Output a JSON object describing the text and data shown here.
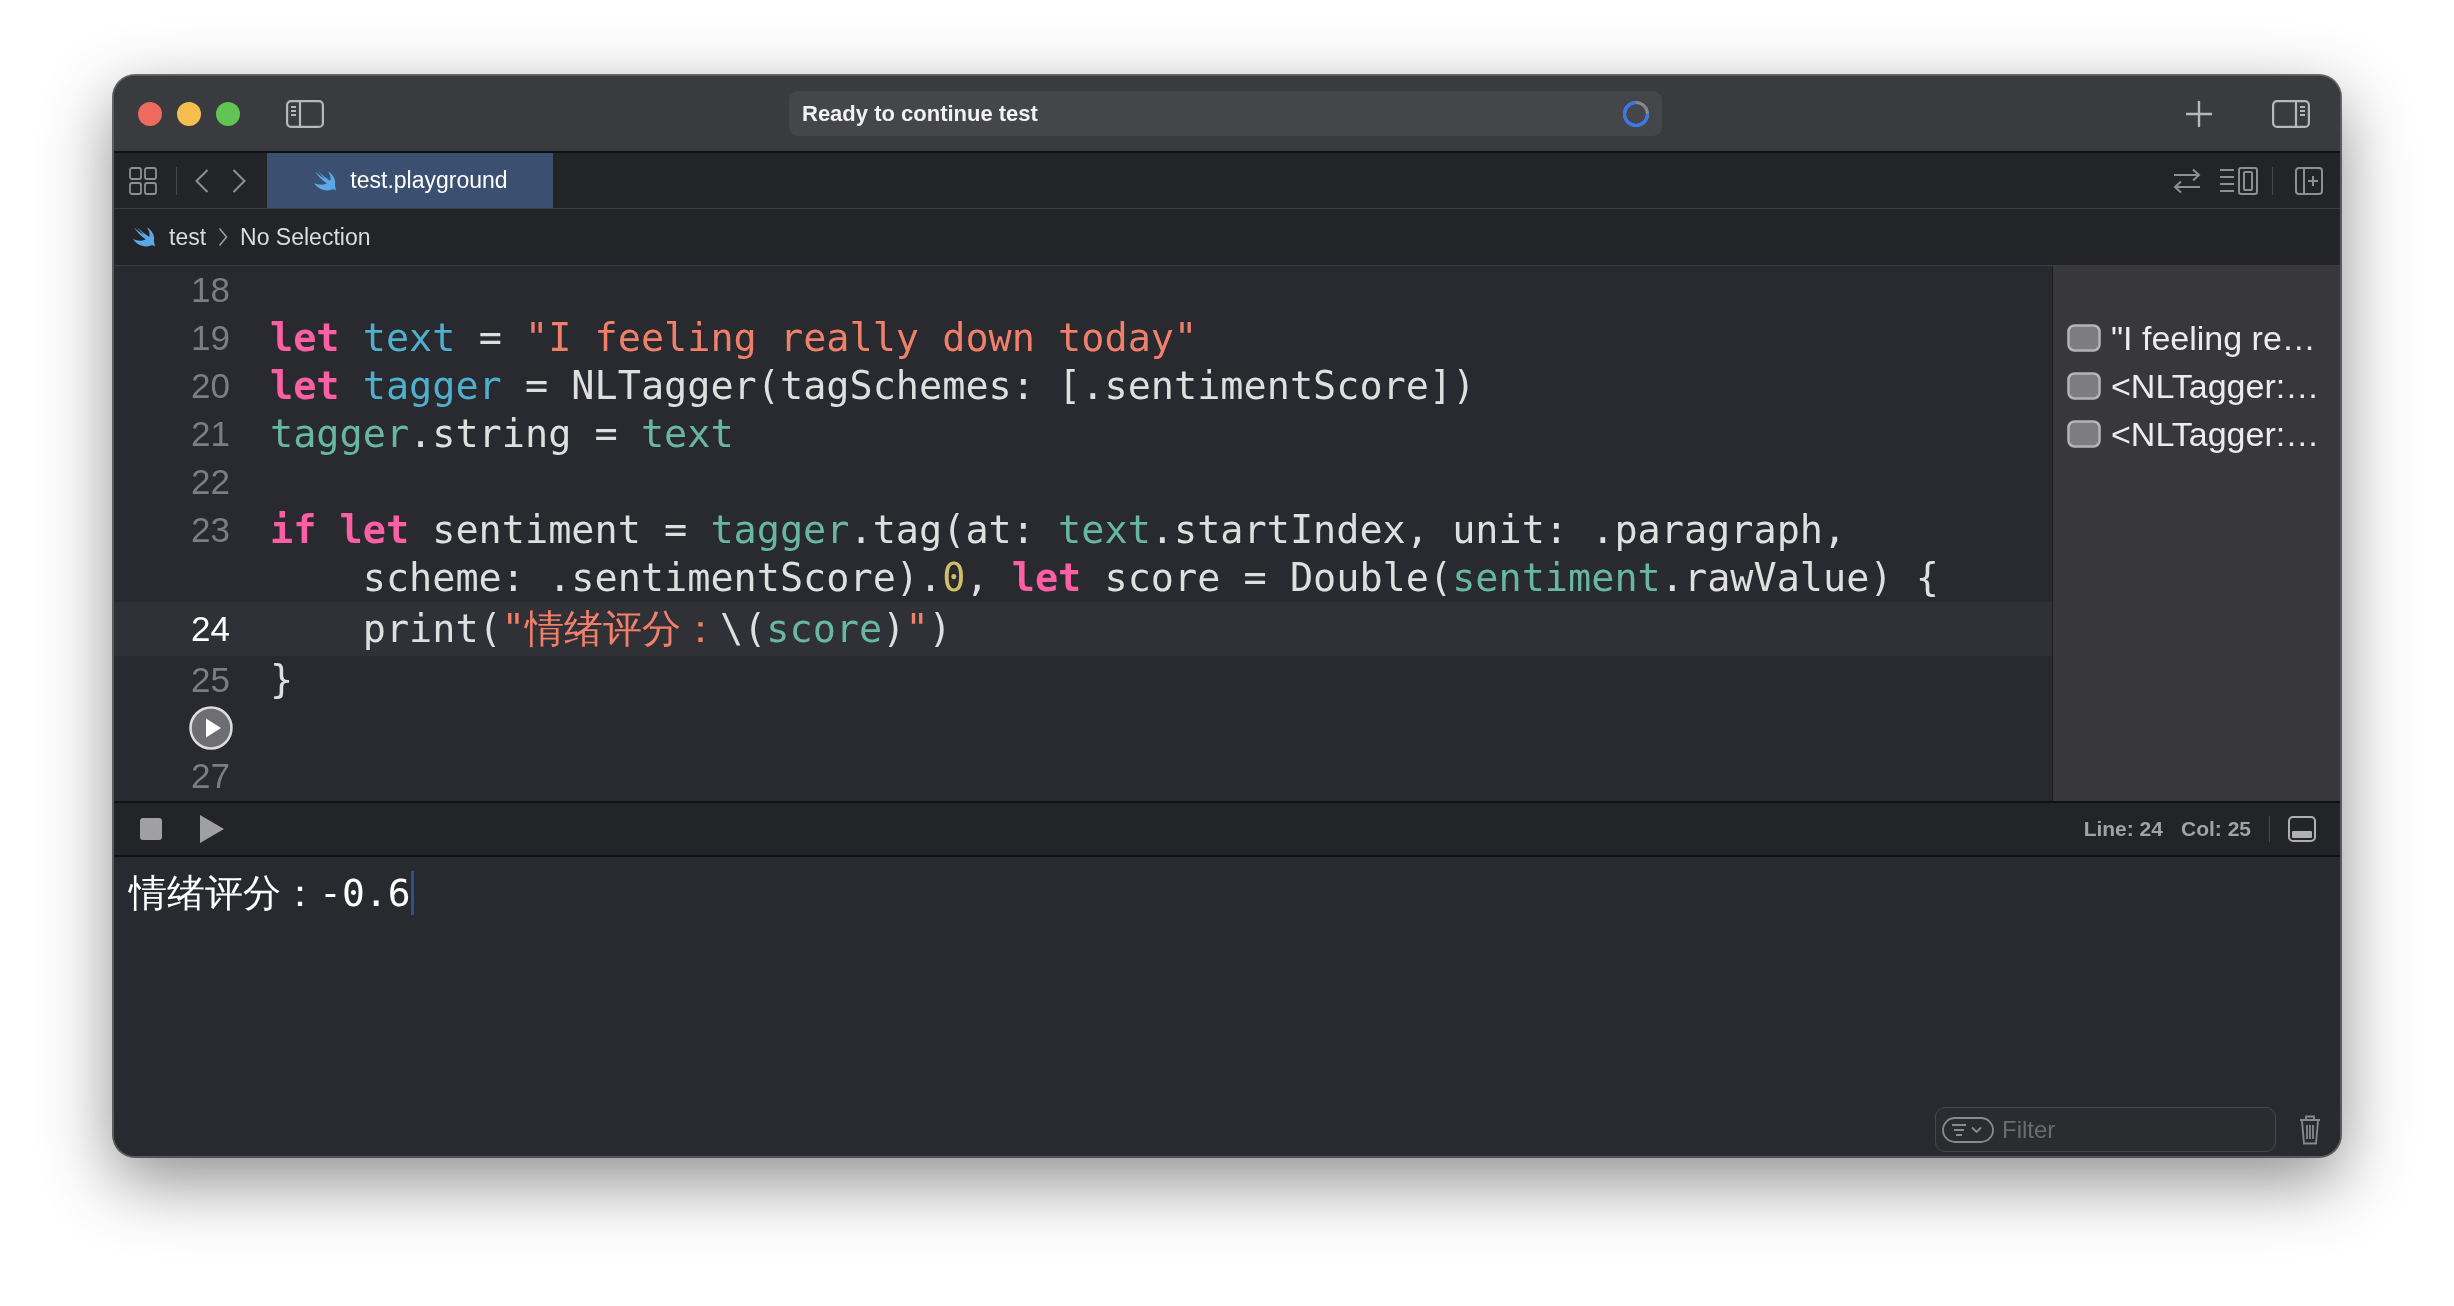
{
  "window": {
    "activity": "Ready to continue test"
  },
  "tabs": [
    {
      "label": "test.playground",
      "selected": true
    }
  ],
  "breadcrumb": [
    {
      "kind": "project",
      "label": "test"
    },
    {
      "kind": "selection",
      "label": "No Selection"
    }
  ],
  "editor": {
    "lines": [
      {
        "kind": "numbered",
        "number": "18",
        "current": false
      },
      {
        "kind": "numbered",
        "number": "19",
        "current": false,
        "rows": [
          {
            "indented": false,
            "tokens": [
              {
                "kind": "keyword",
                "text": "let"
              },
              {
                "kind": "declaration",
                "text": " text"
              },
              {
                "kind": "plain",
                "text": " = "
              },
              {
                "kind": "string",
                "text": "\"I feeling really down today\""
              }
            ]
          }
        ],
        "result": "\"I feeling re…"
      },
      {
        "kind": "numbered",
        "number": "20",
        "current": false,
        "rows": [
          {
            "indented": false,
            "tokens": [
              {
                "kind": "keyword",
                "text": "let"
              },
              {
                "kind": "declaration",
                "text": " tagger"
              },
              {
                "kind": "plain",
                "text": " = NLTagger(tagSchemes: [.sentimentScore])"
              }
            ]
          }
        ],
        "result": "<NLTagger:…"
      },
      {
        "kind": "numbered",
        "number": "21",
        "current": false,
        "rows": [
          {
            "indented": false,
            "tokens": [
              {
                "kind": "reference",
                "text": "tagger"
              },
              {
                "kind": "plain",
                "text": ".string = "
              },
              {
                "kind": "reference",
                "text": "text"
              }
            ]
          }
        ],
        "result": "<NLTagger:…"
      },
      {
        "kind": "numbered",
        "number": "22",
        "current": false
      },
      {
        "kind": "numbered",
        "number": "23",
        "current": false,
        "rows": [
          {
            "indented": false,
            "tokens": [
              {
                "kind": "keyword",
                "text": "if let"
              },
              {
                "kind": "plain",
                "text": " sentiment = "
              },
              {
                "kind": "reference",
                "text": "tagger"
              },
              {
                "kind": "plain",
                "text": ".tag(at: "
              },
              {
                "kind": "reference",
                "text": "text"
              },
              {
                "kind": "plain",
                "text": ".startIndex, unit: .paragraph,"
              }
            ]
          },
          {
            "indented": true,
            "tokens": [
              {
                "kind": "plain",
                "text": "scheme: .sentimentScore)."
              },
              {
                "kind": "number",
                "text": "0"
              },
              {
                "kind": "plain",
                "text": ", "
              },
              {
                "kind": "keyword",
                "text": "let"
              },
              {
                "kind": "plain",
                "text": " score = Double("
              },
              {
                "kind": "reference",
                "text": "sentiment"
              },
              {
                "kind": "plain",
                "text": ".rawValue) {"
              }
            ]
          }
        ]
      },
      {
        "kind": "numbered",
        "number": "24",
        "current": true,
        "rows": [
          {
            "indented": true,
            "tokens": [
              {
                "kind": "plain",
                "text": "print("
              },
              {
                "kind": "string",
                "text": "\"情绪评分："
              },
              {
                "kind": "plain",
                "text": "\\("
              },
              {
                "kind": "reference",
                "text": "score"
              },
              {
                "kind": "plain",
                "text": ")"
              },
              {
                "kind": "string",
                "text": "\""
              },
              {
                "kind": "plain",
                "text": ")"
              }
            ]
          }
        ]
      },
      {
        "kind": "numbered",
        "number": "25",
        "current": false,
        "rows": [
          {
            "indented": false,
            "tokens": [
              {
                "kind": "plain",
                "text": "}"
              }
            ]
          }
        ]
      },
      {
        "kind": "run",
        "current": false
      },
      {
        "kind": "numbered",
        "number": "27",
        "current": false
      }
    ]
  },
  "debug_bar": {
    "line": "Line: 24",
    "column": "Col: 25"
  },
  "console": {
    "output": "情绪评分：-0.6",
    "filter": {
      "placeholder": "Filter"
    }
  }
}
